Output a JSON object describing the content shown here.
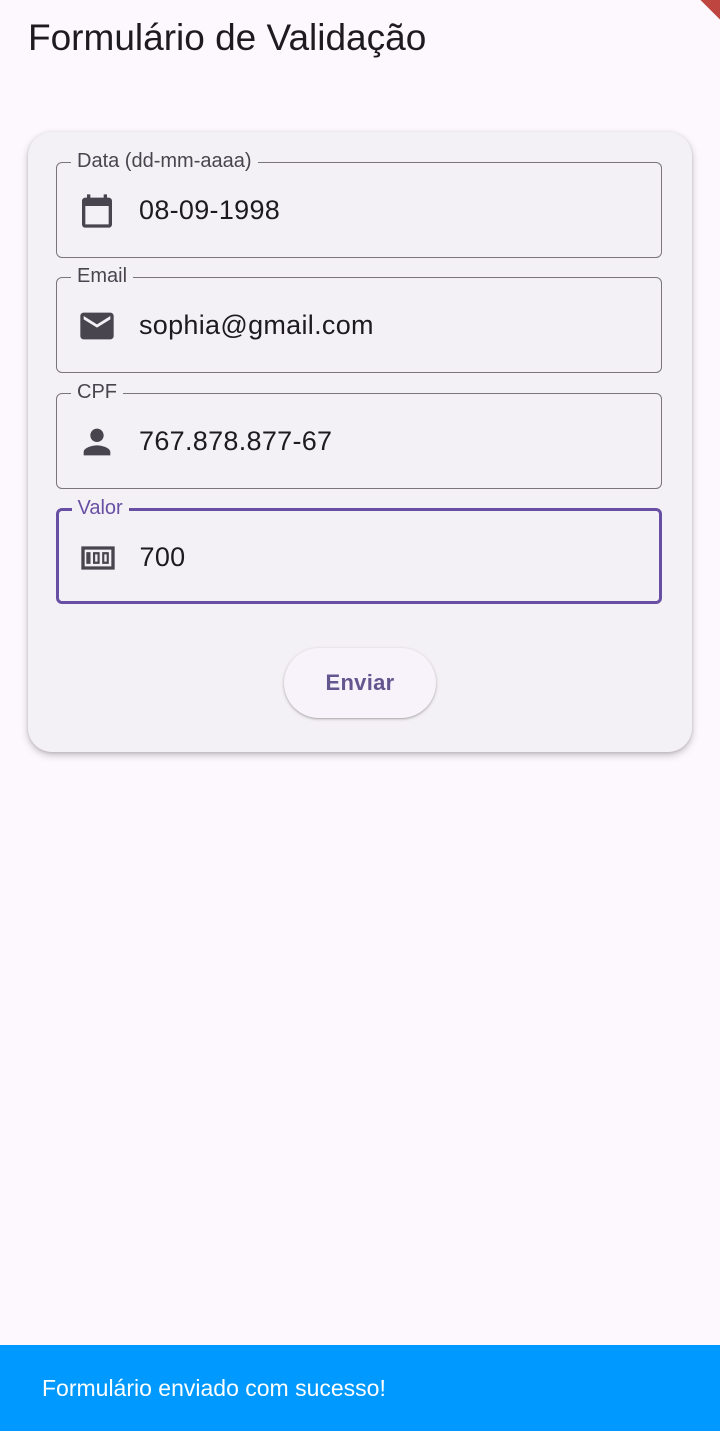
{
  "app_bar": {
    "title": "Formulário de Validação"
  },
  "form": {
    "fields": [
      {
        "label": "Data (dd-mm-aaaa)",
        "value": "08-09-1998",
        "icon": "calendar-icon"
      },
      {
        "label": "Email",
        "value": "sophia@gmail.com",
        "icon": "email-icon"
      },
      {
        "label": "CPF",
        "value": "767.878.877-67",
        "icon": "person-icon"
      },
      {
        "label": "Valor",
        "value": "700",
        "icon": "money-icon",
        "focused": true
      }
    ],
    "submit_label": "Enviar"
  },
  "snackbar": {
    "message": "Formulário enviado com sucesso!"
  },
  "colors": {
    "background": "#fdf7fe",
    "card": "#f4f1f6",
    "outline": "#79747e",
    "primary": "#6750a4",
    "button_text": "#65558f",
    "snackbar": "#0099ff",
    "icon": "#49454f"
  }
}
